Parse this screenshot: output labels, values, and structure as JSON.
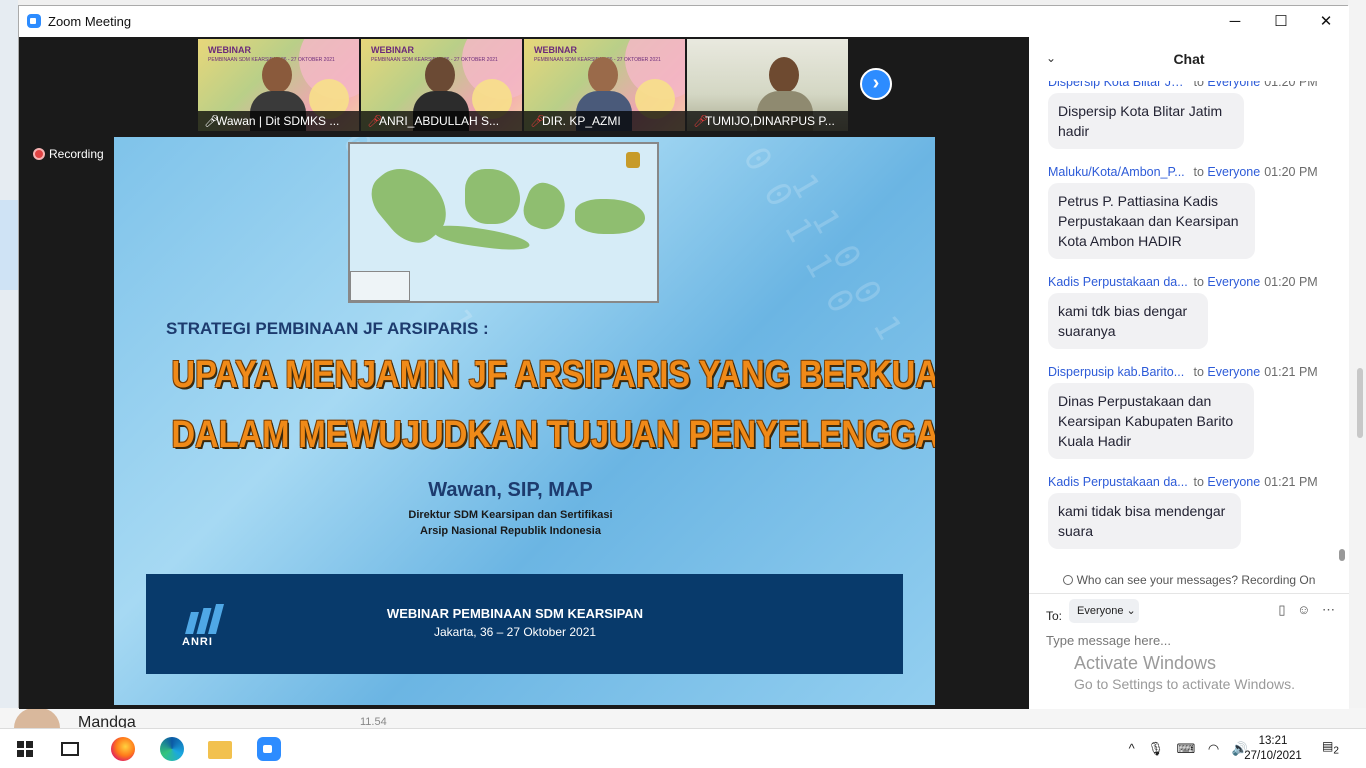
{
  "window": {
    "title": "Zoom Meeting",
    "minimize": "─",
    "maximize": "☐",
    "close": "✕"
  },
  "background_app": {
    "contact_name": "Mandga",
    "contact_time": "11.54"
  },
  "participants": [
    {
      "name": "Wawan | Dit SDMKS ...",
      "muted": false,
      "label": "WEBINAR"
    },
    {
      "name": "ANRI_ABDULLAH S...",
      "muted": true,
      "label": "WEBINAR"
    },
    {
      "name": "DIR. KP_AZMI",
      "muted": true,
      "label": "WEBINAR"
    },
    {
      "name": "TUMIJO,DINARPUS P...",
      "muted": true,
      "label": ""
    }
  ],
  "webinar_badge_sub": "PEMBINAAN SDM KEARSIPAN 26 - 27 OKTOBER 2021",
  "next_button": "›",
  "recording": {
    "label": "Recording"
  },
  "slide": {
    "subtitle": "STRATEGI PEMBINAAN JF ARSIPARIS :",
    "title_line1": "UPAYA MENJAMIN JF ARSIPARIS YANG BERKUALITAS DAN PROFESIONAL",
    "title_line2": "DALAM MEWUJUDKAN TUJUAN PENYELENGGARAAN KEARSIPAN",
    "author": "Wawan, SIP, MAP",
    "role1": "Direktur SDM Kearsipan dan Sertifikasi",
    "role2": "Arsip Nasional Republik Indonesia",
    "logo_text": "ANRI",
    "footer_title": "WEBINAR PEMBINAAN SDM KEARSIPAN",
    "footer_sub": "Jakarta, 36 – 27 Oktober 2021"
  },
  "chat": {
    "header": "Chat",
    "collapse_icon": "chevron-down-icon",
    "messages": [
      {
        "from": "Dispersip Kota Blitar Jat...",
        "to": "to",
        "recipient": "Everyone",
        "time": "01:20 PM",
        "text": "Dispersip Kota Blitar Jatim hadir"
      },
      {
        "from": "Maluku/Kota/Ambon_P...",
        "to": "to",
        "recipient": "Everyone",
        "time": "01:20 PM",
        "text": "Petrus P. Pattiasina Kadis Perpustakaan dan Kearsipan Kota Ambon HADIR"
      },
      {
        "from": "Kadis Perpustakaan da...",
        "to": "to",
        "recipient": "Everyone",
        "time": "01:20 PM",
        "text": "kami tdk bias dengar suaranya"
      },
      {
        "from": "Disperpusip kab.Barito...",
        "to": "to",
        "recipient": "Everyone",
        "time": "01:21 PM",
        "text": "Dinas Perpustakaan dan Kearsipan Kabupaten Barito Kuala Hadir"
      },
      {
        "from": "Kadis Perpustakaan da...",
        "to": "to",
        "recipient": "Everyone",
        "time": "01:21 PM",
        "text": "kami tidak bisa mendengar suara"
      }
    ],
    "privacy_note": "Who can see your messages? Recording On",
    "to_label": "To:",
    "to_value": "Everyone ⌄",
    "input_placeholder": "Type message here...",
    "file_icon": "▯",
    "emoji_icon": "☺",
    "more_icon": "⋯"
  },
  "activation": {
    "line1": "Activate Windows",
    "line2": "Go to Settings to activate Windows."
  },
  "taskbar": {
    "time": "13:21",
    "date": "27/10/2021",
    "tray_chevron": "^",
    "tray_mic": "🎙",
    "tray_ime": "⌨",
    "tray_wifi": "◠",
    "tray_volume": "🔊",
    "notifications": "2"
  }
}
